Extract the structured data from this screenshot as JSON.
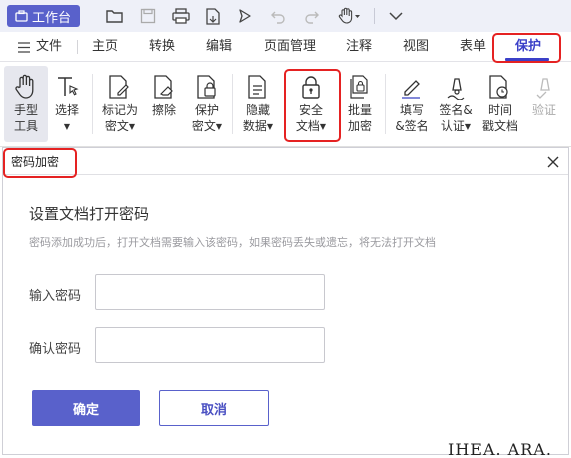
{
  "titlebar": {
    "workbench_label": "工作台",
    "icons": [
      "folder-open-icon",
      "save-icon",
      "print-icon",
      "file-export-icon",
      "share-icon",
      "undo-icon",
      "redo-icon",
      "hand-tool-icon",
      "dropdown-icon"
    ]
  },
  "tabs": {
    "file_label": "文件",
    "items": [
      "主页",
      "转换",
      "编辑",
      "页面管理",
      "注释",
      "视图",
      "表单",
      "保护"
    ],
    "active": "保护"
  },
  "ribbon": {
    "hand_tool": {
      "line1": "手型",
      "line2": "工具"
    },
    "select": {
      "line1": "选择"
    },
    "mark_secret": {
      "line1": "标记为",
      "line2": "密文"
    },
    "erase": {
      "line1": "擦除"
    },
    "protect_secret": {
      "line1": "保护",
      "line2": "密文"
    },
    "hide_data": {
      "line1": "隐藏",
      "line2": "数据"
    },
    "secure_doc": {
      "line1": "安全",
      "line2": "文档"
    },
    "batch_encrypt": {
      "line1": "批量",
      "line2": "加密"
    },
    "fill_sign": {
      "line1": "填写",
      "line2": "&签名"
    },
    "sign_cert": {
      "line1": "签名&",
      "line2": "认证"
    },
    "timestamp_doc": {
      "line1": "时间",
      "line2": "戳文档"
    },
    "verify": {
      "line1": "验证"
    }
  },
  "dialog": {
    "title": "密码加密",
    "heading": "设置文档打开密码",
    "hint": "密码添加成功后，打开文档需要输入该密码，如果密码丢失或遗忘，将无法打开文档",
    "password_label": "输入密码",
    "password_value": "",
    "confirm_label": "确认密码",
    "confirm_value": "",
    "ok_label": "确定",
    "cancel_label": "取消"
  },
  "background_peek": "IHEA. ARA. LE",
  "colors": {
    "accent": "#5961cb",
    "active_tab": "#3b40c8",
    "highlight": "#e52222"
  }
}
